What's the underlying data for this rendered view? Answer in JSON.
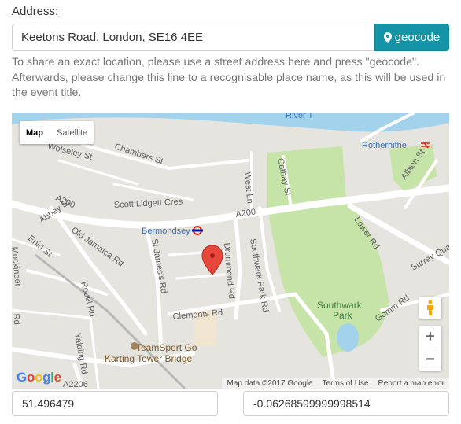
{
  "address": {
    "label": "Address:",
    "value": "Keetons Road, London, SE16 4EE",
    "geocode_label": "geocode",
    "help_text": "To share an exact location, please use a street address here and press \"geocode\". Afterwards, please change this line to a recognisable place name, as this will be used in the event title."
  },
  "map": {
    "type_control": {
      "map_label": "Map",
      "satellite_label": "Satellite",
      "selected": "Map"
    },
    "labels": {
      "river": "River T",
      "rotherhithe": "Rotherhithe",
      "bermondsey": "Bermondsey",
      "southwark_park_1": "Southwark",
      "southwark_park_2": "Park",
      "teamsport_1": "TeamSport Go",
      "teamsport_2": "Karting Tower Bridge",
      "chambers_st": "Chambers St",
      "wolseley_st": "Wolseley St",
      "scott_lidgett": "Scott Lidgett Cres",
      "a200_left": "A200",
      "a200_mid": "A200",
      "abbey_st": "Abbey St",
      "old_jamaica": "Old Jamaica Rd",
      "enid_st": "Enid St",
      "st_james": "St James's Rd",
      "drummond": "Drummond Rd",
      "southwark_park_rd": "Southwark Park Rd",
      "west_ln": "West Ln",
      "cathay_st": "Cathay St",
      "lower_rd": "Lower Rd",
      "albion_st": "Albion St",
      "surrey_qua": "Surrey Qua",
      "clements_rd": "Clements Rd",
      "rouel_rd": "Rouel Rd",
      "yalding_rd": "Yalding Rd",
      "gomm_rd": "Gomm Rd",
      "a2206": "A2206",
      "mockinger": "Mockinger",
      "rd_left": "Rd"
    },
    "attribution": {
      "map_data": "Map data ©2017 Google",
      "terms": "Terms of Use",
      "report": "Report a map error"
    },
    "logo_text": "Google",
    "colors": {
      "park": "#c6e3a8",
      "water": "#a2d2ec",
      "road": "#ffffff",
      "land": "#e6e4df",
      "marker": "#e8473b"
    }
  },
  "coords": {
    "latitude": "51.496479",
    "longitude": "-0.06268599999998514"
  }
}
